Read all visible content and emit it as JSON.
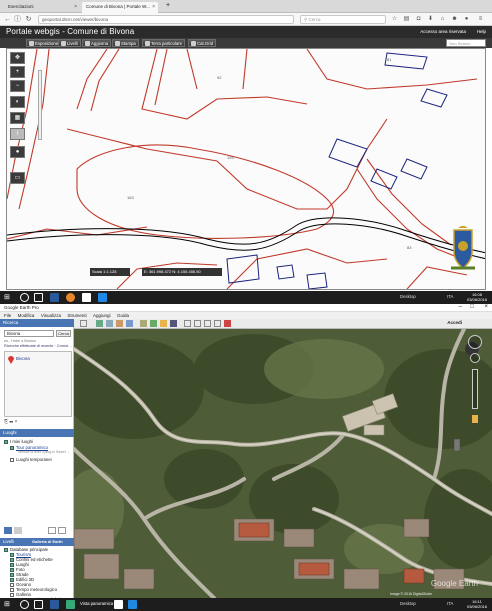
{
  "browser": {
    "tabs": [
      {
        "label": "Esercitazioni",
        "active": false
      },
      {
        "label": "Comune di Bivona | Portale W...",
        "active": true
      },
      {
        "label": "+",
        "active": false
      }
    ],
    "url": "geoportal.dtcm.net/viewer/bivona",
    "search_placeholder": "Cerca"
  },
  "webgis": {
    "title": "Portale webgis - Comune di Bivona",
    "login": "Accesso area riservata",
    "help": "Help",
    "toolbar": [
      {
        "label": "Esposizione"
      },
      {
        "label": "Livelli"
      },
      {
        "label": "Aggiorna"
      },
      {
        "label": "Stampa"
      },
      {
        "label": "Terra particolare"
      },
      {
        "label": "Cat.Grid"
      }
    ],
    "geosearch_placeholder": "Geo Search",
    "scale_text": "Scala 1:1.128",
    "coord_text": "E: 361.998.472  N: 4.155.455.50"
  },
  "taskbar": {
    "desktop_label": "Desktop",
    "lang": "ITA",
    "time_top": "16:08",
    "date_top": "03/06/2016",
    "time_bottom": "16:11",
    "date_bottom": "03/06/2016"
  },
  "google_earth": {
    "window_title": "Google Earth Pro",
    "menu": [
      "File",
      "Modifica",
      "Visualizza",
      "Strumenti",
      "Aggiungi",
      "Guida"
    ],
    "search_header": "Ricerca",
    "search_value": "Bivona",
    "search_button": "Cerca",
    "search_link": "es., Hotel a Boston",
    "search_history_label": "Ricerche effettuate di recente · Cronologia",
    "result_label": "Bivona",
    "places_header": "Luoghi",
    "places": [
      {
        "label": "I miei luoghi",
        "checked": true
      },
      {
        "label": "Tour panoramico",
        "checked": true
      },
      {
        "label": "Tour del Google Earth",
        "checked": false
      },
      {
        "label": "Luoghi temporanei",
        "checked": false
      }
    ],
    "places_sub": "Verifica di aver il plug-in Sweet Drive (R) è installato",
    "layers_header": "Livelli",
    "layers_gallery": "Galleria di Earth",
    "layers": [
      {
        "label": "Database principale",
        "checked": true
      },
      {
        "label": "Tourism",
        "checked": true
      },
      {
        "label": "Confini ed etichette",
        "checked": true
      },
      {
        "label": "Luoghi",
        "checked": true
      },
      {
        "label": "Foto",
        "checked": true
      },
      {
        "label": "Strade",
        "checked": true
      },
      {
        "label": "Edifici 3D",
        "checked": true
      },
      {
        "label": "Oceano",
        "checked": false
      },
      {
        "label": "Tempo meteorologico",
        "checked": false
      },
      {
        "label": "Galleria",
        "checked": false
      },
      {
        "label": "Consapevolezza globale",
        "checked": false
      }
    ],
    "accedi": "Accedi",
    "map_copyright": "Image © 2016 DigitalGlobe",
    "watermark": "Google Earth",
    "status_text": "Vista panoramica"
  }
}
